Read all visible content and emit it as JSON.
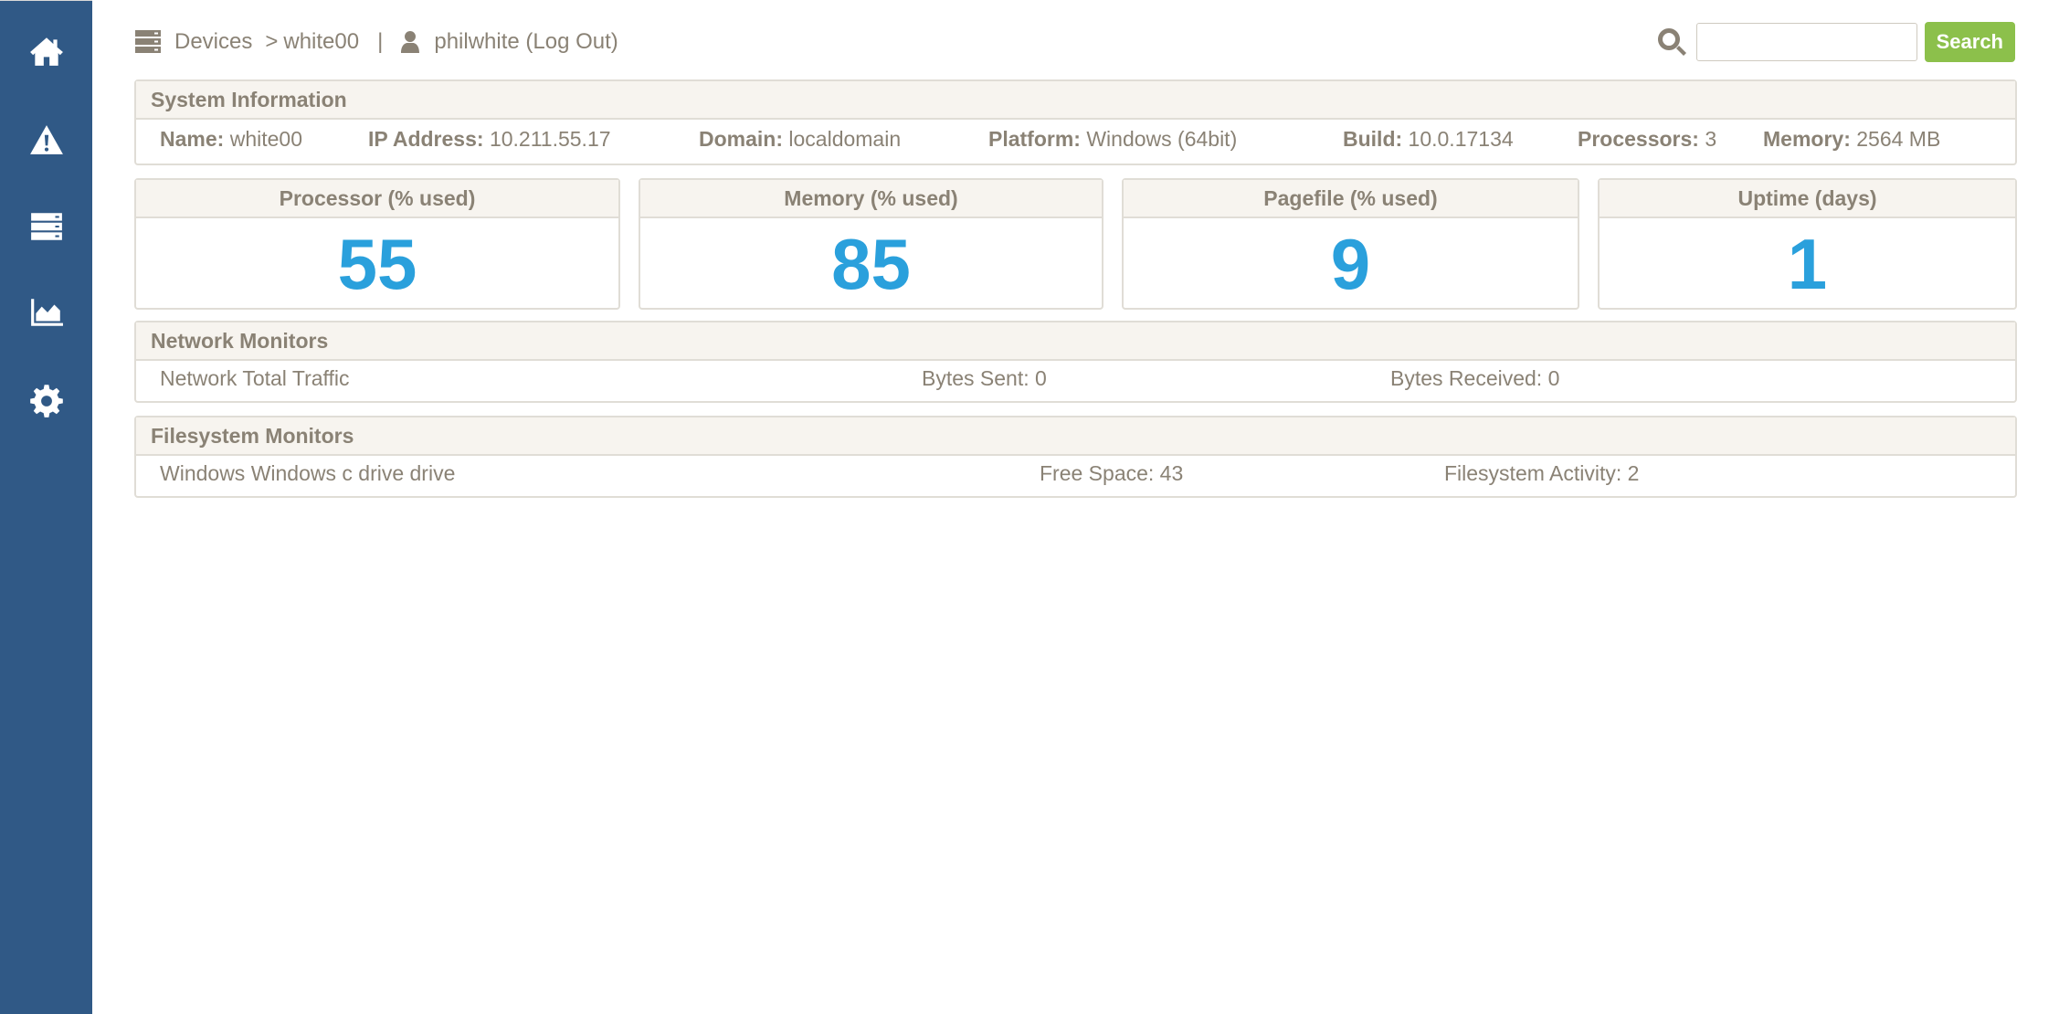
{
  "sidebar": {
    "items": [
      {
        "icon": "home-icon"
      },
      {
        "icon": "alert-icon"
      },
      {
        "icon": "server-icon"
      },
      {
        "icon": "chart-icon"
      },
      {
        "icon": "gear-icon"
      }
    ]
  },
  "breadcrumb": {
    "devices": "Devices",
    "separator": ">",
    "device": "white00",
    "pipe": "|",
    "user": "philwhite (Log Out)"
  },
  "search": {
    "placeholder": "",
    "button": "Search"
  },
  "system_info": {
    "title": "System Information",
    "name_label": "Name:",
    "name": "white00",
    "ip_label": "IP Address:",
    "ip": "10.211.55.17",
    "domain_label": "Domain:",
    "domain": "localdomain",
    "platform_label": "Platform:",
    "platform": "Windows (64bit)",
    "build_label": "Build:",
    "build": "10.0.17134",
    "processors_label": "Processors:",
    "processors": "3",
    "memory_label": "Memory:",
    "memory": "2564 MB"
  },
  "metrics": [
    {
      "title": "Processor (% used)",
      "value": "55"
    },
    {
      "title": "Memory (% used)",
      "value": "85"
    },
    {
      "title": "Pagefile (% used)",
      "value": "9"
    },
    {
      "title": "Uptime (days)",
      "value": "1"
    }
  ],
  "network": {
    "title": "Network Monitors",
    "name": "Network Total Traffic",
    "sent": "Bytes Sent: 0",
    "received": "Bytes Received: 0"
  },
  "filesystem": {
    "title": "Filesystem Monitors",
    "name": "Windows Windows c drive drive",
    "free": "Free Space: 43",
    "activity": "Filesystem Activity: 2"
  },
  "colors": {
    "sidebar": "#305986",
    "accent_value": "#2aa0dc",
    "search_button": "#8cc04b",
    "text": "#8a8275"
  }
}
